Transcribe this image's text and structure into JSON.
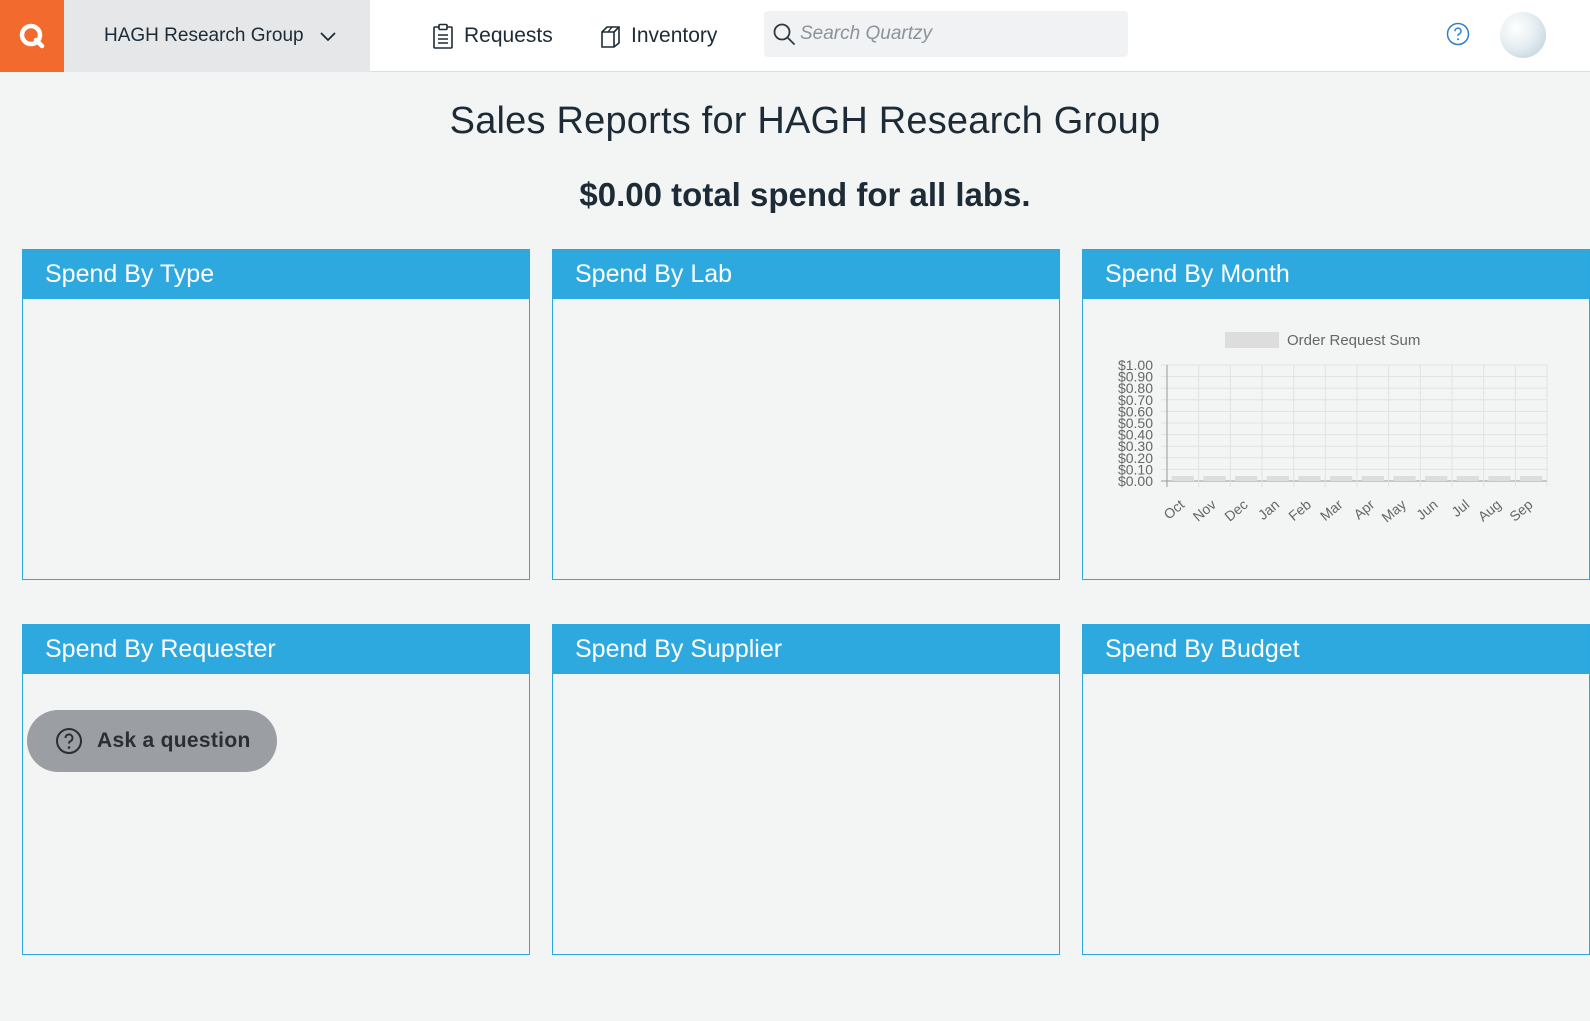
{
  "topbar": {
    "org_name": "HAGH Research Group",
    "nav": {
      "requests": "Requests",
      "inventory": "Inventory"
    },
    "search_placeholder": "Search Quartzy",
    "brand_color": "#f26a2e"
  },
  "page": {
    "title": "Sales Reports for HAGH Research Group",
    "total_amount": "$0.00",
    "total_rest": " total spend for all labs."
  },
  "cards": {
    "by_type": "Spend By Type",
    "by_lab": "Spend By Lab",
    "by_month": "Spend By Month",
    "by_requester": "Spend By Requester",
    "by_supplier": "Spend By Supplier",
    "by_budget": "Spend By Budget",
    "header_color": "#2ea9e0"
  },
  "chart_data": {
    "type": "bar",
    "categories": [
      "Oct",
      "Nov",
      "Dec",
      "Jan",
      "Feb",
      "Mar",
      "Apr",
      "May",
      "Jun",
      "Jul",
      "Aug",
      "Sep"
    ],
    "series": [
      {
        "name": "Order Request Sum",
        "values": [
          0,
          0,
          0,
          0,
          0,
          0,
          0,
          0,
          0,
          0,
          0,
          0
        ],
        "color": "#dddddd"
      }
    ],
    "yticks": [
      "$0.00",
      "$0.10",
      "$0.20",
      "$0.30",
      "$0.40",
      "$0.50",
      "$0.60",
      "$0.70",
      "$0.80",
      "$0.90",
      "$1.00"
    ],
    "ylim": [
      0,
      1
    ],
    "grid": true,
    "legend": "top"
  },
  "help_widget": {
    "label": "Ask a question"
  }
}
